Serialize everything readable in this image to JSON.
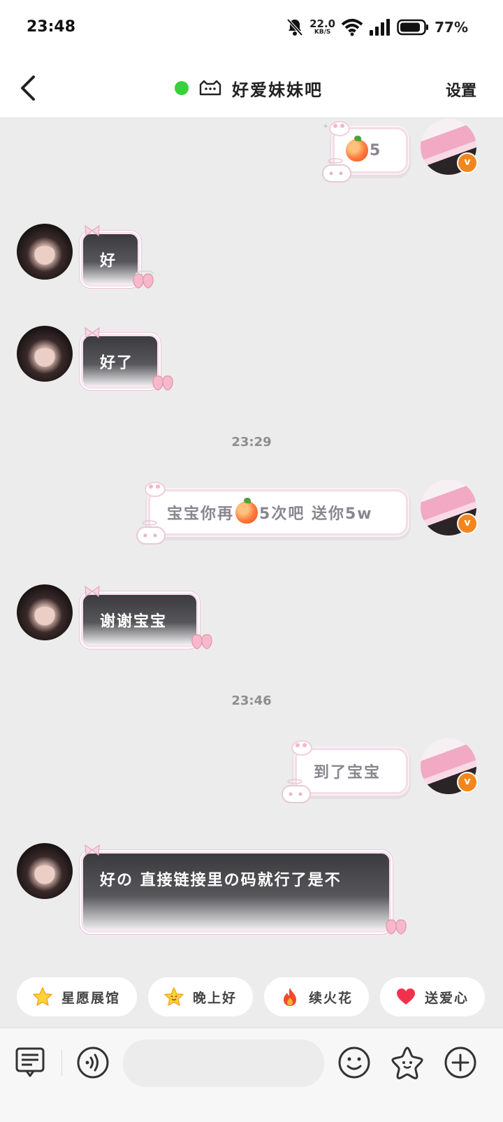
{
  "status_bar": {
    "time": "23:48",
    "net_speed": "22.0",
    "net_unit": "KB/S",
    "battery": "77%"
  },
  "header": {
    "title": "好爱妹妹吧",
    "settings_label": "设置",
    "online_color": "#38d13a"
  },
  "messages": [
    {
      "side": "right",
      "text": "5",
      "prefix_icon": "peach-emoji"
    },
    {
      "side": "left",
      "text": "好"
    },
    {
      "side": "left",
      "text": "好了"
    },
    {
      "side": "right",
      "text_before": "宝宝你再",
      "text_after": "5次吧 送你5w",
      "inline_icon": "peach-emoji"
    },
    {
      "side": "left",
      "text": "谢谢宝宝"
    },
    {
      "side": "right",
      "text": "到了宝宝"
    },
    {
      "side": "left",
      "text": "好の 直接链接里の码就行了是不"
    }
  ],
  "timestamps": [
    "23:29",
    "23:46"
  ],
  "quick_replies": [
    {
      "label": "星愿展馆",
      "icon": "star-icon"
    },
    {
      "label": "晚上好",
      "icon": "star-face-icon"
    },
    {
      "label": "续火花",
      "icon": "fire-icon"
    },
    {
      "label": "送爱心",
      "icon": "heart-icon"
    }
  ],
  "colors": {
    "verified_badge": "#f2861e",
    "dark_bubble_border": "#f8e2ec",
    "fire": "#f24a2a",
    "heart": "#f2324d"
  }
}
